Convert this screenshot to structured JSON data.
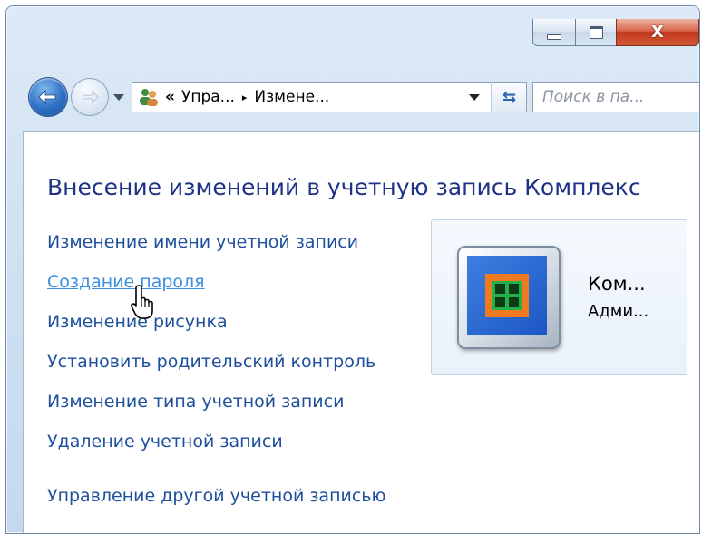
{
  "window": {
    "caption": {
      "close_label": "X"
    }
  },
  "nav": {
    "breadcrumb": [
      "Упра...",
      "Измене..."
    ],
    "overflow_chevron": "«",
    "separator": "▸",
    "refresh_glyph": "⇆",
    "search_placeholder": "Поиск в па..."
  },
  "content": {
    "title": "Внесение изменений в учетную запись Комплекс",
    "tasks": [
      "Изменение имени учетной записи",
      "Создание пароля",
      "Изменение рисунка",
      "Установить родительский контроль",
      "Изменение типа учетной записи",
      "Удаление учетной записи",
      "Управление другой учетной записью"
    ],
    "hovered_task": "Создание пароля"
  },
  "account": {
    "name": "Ком...",
    "role": "Адми..."
  },
  "icons": [
    "back-arrow-icon",
    "forward-arrow-icon",
    "users-icon",
    "refresh-icon",
    "minimize-icon",
    "maximize-icon",
    "close-icon",
    "hand-cursor-icon",
    "account-picture-icon"
  ],
  "colors": {
    "link": "#1e4f9c",
    "link_hover": "#3a8fe0",
    "title": "#1e3287",
    "close_button": "#c2381e"
  }
}
